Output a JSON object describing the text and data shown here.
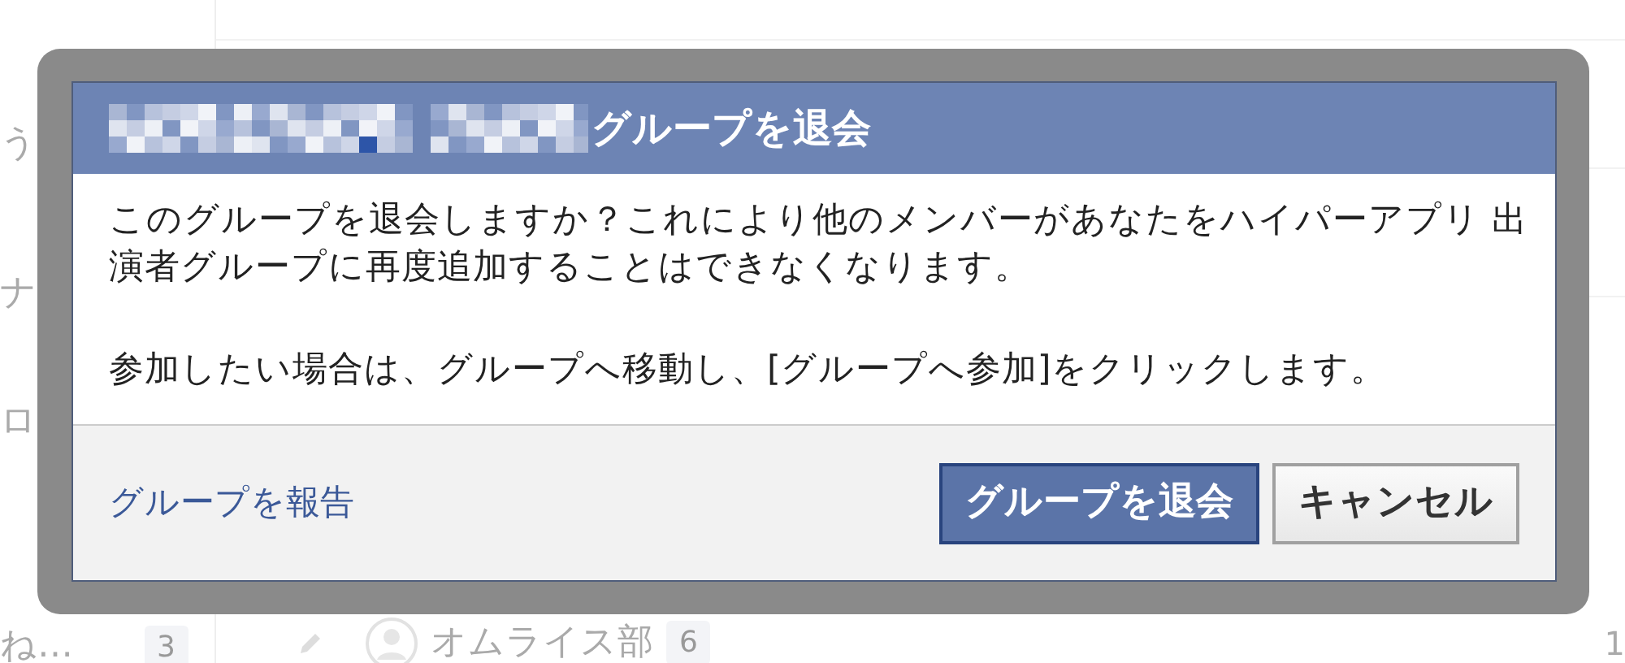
{
  "background": {
    "sidebar_items": [
      {
        "label": "う"
      },
      {
        "label": "ナ"
      },
      {
        "label": "ロ"
      },
      {
        "label": "ね…",
        "count": "3"
      }
    ],
    "group_row": {
      "name": "オムライス部",
      "count": "6"
    },
    "right_count": "1"
  },
  "dialog": {
    "title": "グループを退会",
    "paragraphs": [
      "このグループを退会しますか？これにより他のメンバーがあなたをハイパーアプリ 出演者グループに再度追加することはできなくなります。",
      "参加したい場合は、グループへ移動し、[グループへ参加]をクリックします。"
    ],
    "report_link": "グループを報告",
    "buttons": [
      {
        "label": "グループを退会",
        "kind": "primary"
      },
      {
        "label": "キャンセル",
        "kind": "secondary"
      }
    ]
  }
}
